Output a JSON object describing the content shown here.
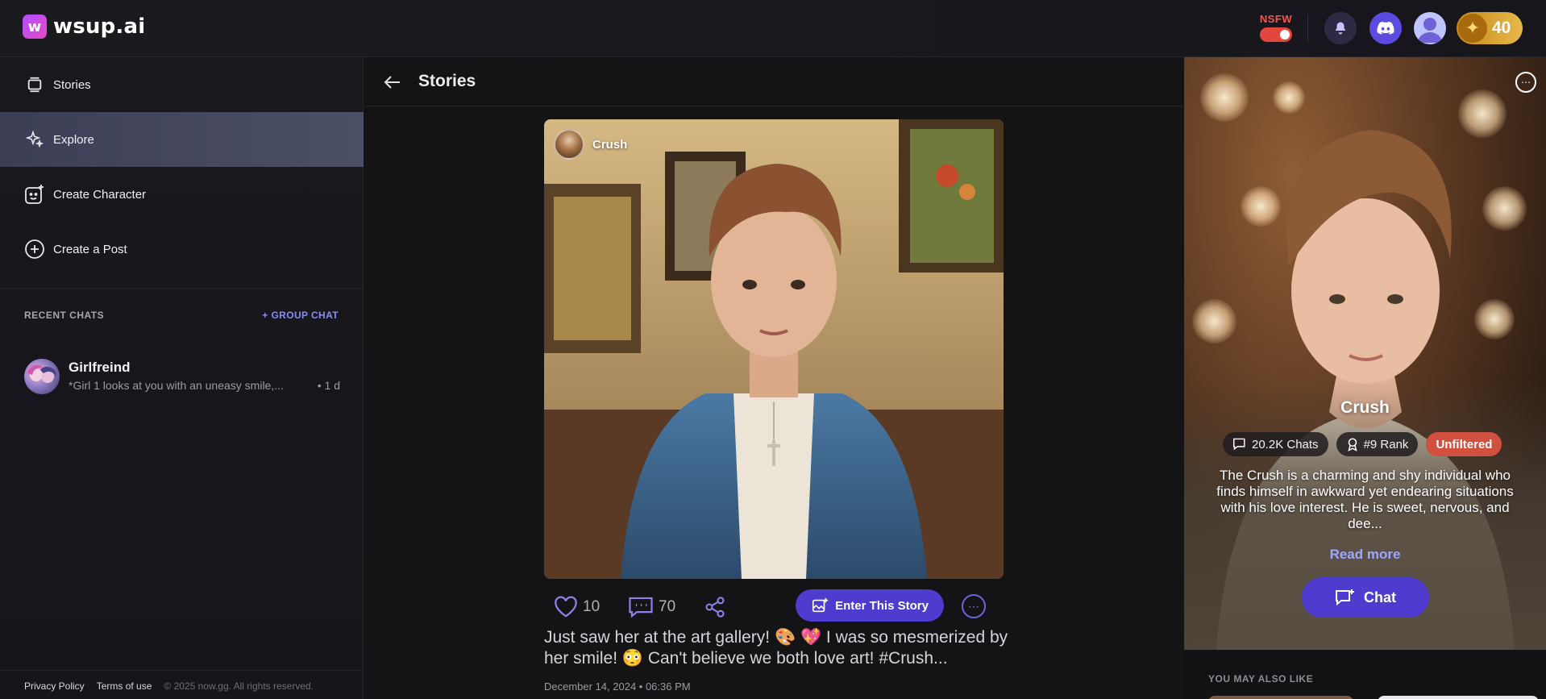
{
  "brand": {
    "name": "wsup.ai",
    "mark": "w"
  },
  "header": {
    "nsfw_label": "NSFW",
    "coins": "40"
  },
  "sidebar": {
    "items": [
      {
        "label": "Stories",
        "icon": "stories-icon"
      },
      {
        "label": "Explore",
        "icon": "sparkle-icon"
      },
      {
        "label": "Create Character",
        "icon": "create-character-icon"
      },
      {
        "label": "Create a Post",
        "icon": "plus-circle-icon"
      }
    ],
    "recent_title": "RECENT CHATS",
    "group_chat": "+ GROUP CHAT",
    "chats": [
      {
        "name": "Girlfreind",
        "snippet": "*Girl 1 looks at you with an uneasy smile,...",
        "time": "• 1 d"
      }
    ],
    "footer": {
      "privacy": "Privacy Policy",
      "terms": "Terms of use",
      "copyright": "© 2025 now.gg. All rights reserved."
    }
  },
  "main": {
    "title": "Stories",
    "post": {
      "author": "Crush",
      "likes": "10",
      "comments": "70",
      "enter_label": "Enter This Story",
      "caption": "Just saw her at the art gallery! 🎨 💖 I was so mesmerized by her smile! 😳 Can't believe we both love art! #Crush...",
      "date": "December 14, 2024 • 06:36 PM"
    }
  },
  "character": {
    "name": "Crush",
    "chats": "20.2K Chats",
    "rank": "#9 Rank",
    "tag": "Unfiltered",
    "description": "The Crush is a charming and shy individual who finds himself in awkward yet endearing situations with his love interest. He is sweet, nervous, and dee...",
    "read_more": "Read more",
    "chat_label": "Chat",
    "also_like": "YOU MAY ALSO LIKE"
  },
  "colors": {
    "accent": "#4e3ccf",
    "nsfw": "#e2463c",
    "link": "#8a8cf5",
    "unfiltered": "#d2503f"
  }
}
